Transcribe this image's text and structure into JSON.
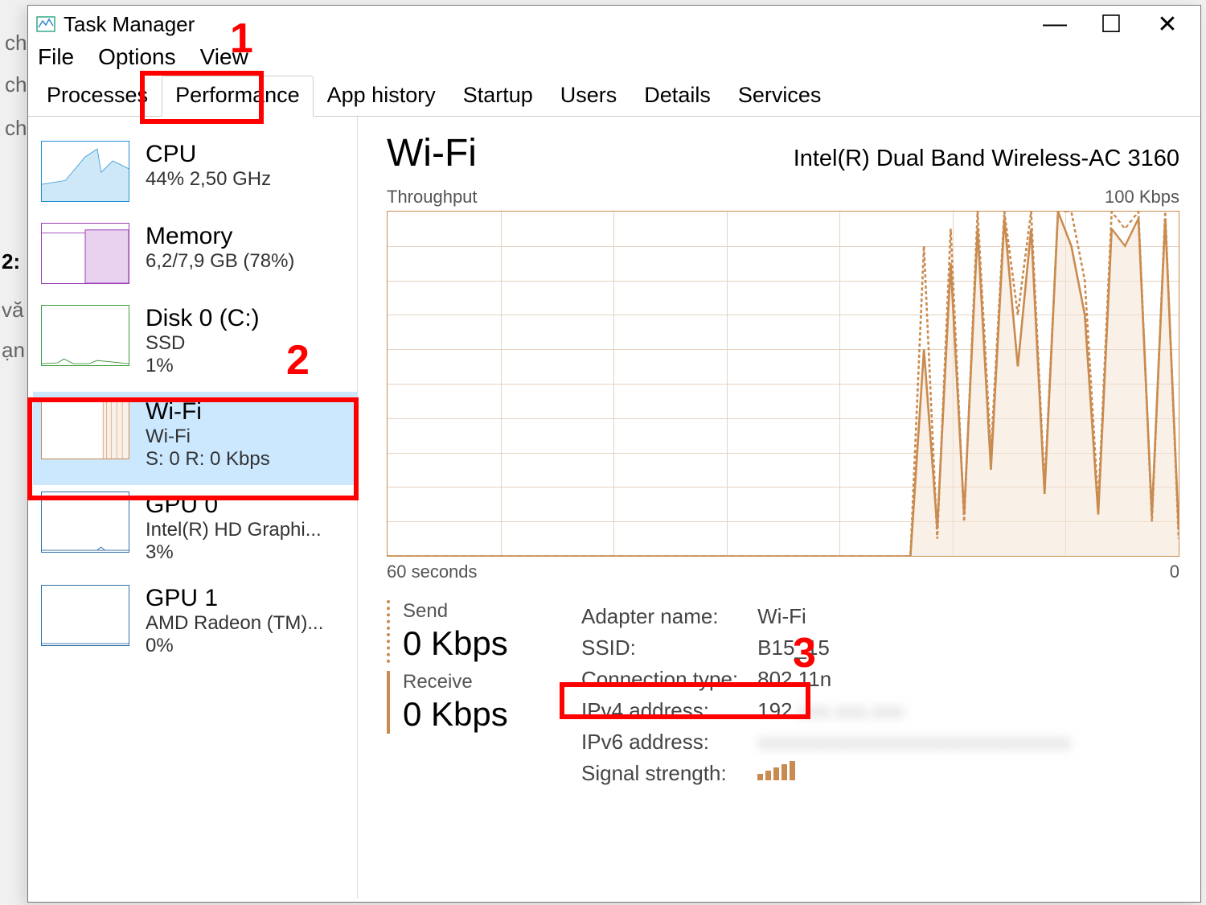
{
  "bg": {
    "t1": "ch",
    "t2": "ch",
    "t3": "ch",
    "t4": "2:",
    "t5": "vă",
    "t6": "ạn"
  },
  "window": {
    "title": "Task Manager",
    "menu": [
      "File",
      "Options",
      "View"
    ],
    "controls": {
      "min": "—",
      "max": "☐",
      "close": "✕"
    }
  },
  "tabs": [
    "Processes",
    "Performance",
    "App history",
    "Startup",
    "Users",
    "Details",
    "Services"
  ],
  "active_tab": "Performance",
  "sidebar": [
    {
      "title": "CPU",
      "sub": "44% 2,50 GHz",
      "color": "#1e90d6"
    },
    {
      "title": "Memory",
      "sub": "6,2/7,9 GB (78%)",
      "color": "#9b3fb5"
    },
    {
      "title": "Disk 0 (C:)",
      "sub": "SSD\n1%",
      "color": "#3c9a3c"
    },
    {
      "title": "Wi-Fi",
      "sub": "Wi-Fi\nS: 0 R: 0 Kbps",
      "color": "#c98b4f",
      "selected": true
    },
    {
      "title": "GPU 0",
      "sub": "Intel(R) HD Graphi...\n3%",
      "color": "#2f6fa8"
    },
    {
      "title": "GPU 1",
      "sub": "AMD Radeon (TM)...\n0%",
      "color": "#2f6fa8"
    }
  ],
  "main": {
    "title": "Wi-Fi",
    "adapter": "Intel(R) Dual Band Wireless-AC 3160",
    "chart_top_left": "Throughput",
    "chart_top_right": "100 Kbps",
    "chart_bot_left": "60 seconds",
    "chart_bot_right": "0",
    "send_label": "Send",
    "send_value": "0 Kbps",
    "receive_label": "Receive",
    "receive_value": "0 Kbps",
    "info": [
      {
        "k": "Adapter name:",
        "v": "Wi-Fi"
      },
      {
        "k": "SSID:",
        "v": "B15_15"
      },
      {
        "k": "Connection type:",
        "v": "802.11n"
      },
      {
        "k": "IPv4 address:",
        "v": "192."
      },
      {
        "k": "IPv6 address:",
        "v": "",
        "blur": true
      },
      {
        "k": "Signal strength:",
        "v": "",
        "signal": true
      }
    ]
  },
  "annotations": {
    "a1": "1",
    "a2": "2",
    "a3": "3"
  },
  "chart_data": {
    "type": "line",
    "title": "Wi-Fi Throughput",
    "xlabel": "seconds",
    "ylabel": "Kbps",
    "xlim": [
      0,
      60
    ],
    "ylim": [
      0,
      100
    ],
    "series": [
      {
        "name": "Send",
        "values": [
          0,
          0,
          0,
          0,
          0,
          0,
          0,
          0,
          0,
          0,
          0,
          0,
          0,
          0,
          0,
          0,
          0,
          0,
          0,
          0,
          0,
          0,
          0,
          0,
          0,
          0,
          0,
          0,
          0,
          0,
          0,
          0,
          0,
          0,
          0,
          0,
          0,
          0,
          0,
          0,
          90,
          5,
          95,
          10,
          100,
          30,
          100,
          70,
          100,
          20,
          100,
          100,
          80,
          15,
          100,
          95,
          100,
          10,
          100,
          5
        ]
      },
      {
        "name": "Receive",
        "values": [
          0,
          0,
          0,
          0,
          0,
          0,
          0,
          0,
          0,
          0,
          0,
          0,
          0,
          0,
          0,
          0,
          0,
          0,
          0,
          0,
          0,
          0,
          0,
          0,
          0,
          0,
          0,
          0,
          0,
          0,
          0,
          0,
          0,
          0,
          0,
          0,
          0,
          0,
          0,
          0,
          60,
          8,
          85,
          12,
          95,
          25,
          98,
          55,
          95,
          18,
          100,
          90,
          70,
          12,
          95,
          90,
          98,
          12,
          98,
          8
        ]
      }
    ]
  }
}
